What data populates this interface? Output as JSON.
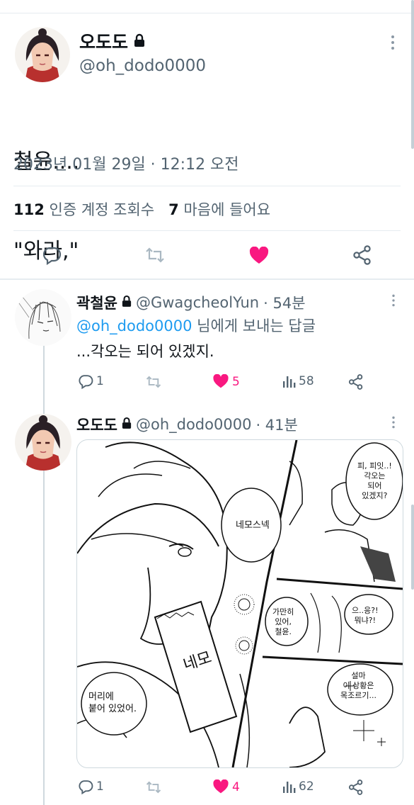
{
  "main_tweet": {
    "name": "오도도",
    "handle": "@oh_dodo0000",
    "text_line1": "철윤....",
    "text_line2": "\"와라,\"",
    "timestamp": "2023년 01월 29일 · 12:12 오전",
    "views_count": "112",
    "views_label": "인증 계정 조회수",
    "likes_count": "7",
    "likes_label": "마음에 들어요"
  },
  "reply1": {
    "name": "곽철윤",
    "handle": "@GwagcheolYun",
    "time": "· 54분",
    "reply_to_handle": "@oh_dodo0000",
    "reply_to_suffix": "님에게 보내는 답글",
    "text": "...각오는 되어 있겠지.",
    "replies": "1",
    "likes": "5",
    "views": "58"
  },
  "reply2": {
    "name": "오도도",
    "handle": "@oh_dodo0000",
    "time": "· 41분",
    "replies": "1",
    "likes": "4",
    "views": "62",
    "comic": {
      "bubble_nemo": "네모스넥",
      "bubble_hair": "머리에\n붙어 있었어.",
      "bubble_top_right": "피, 피잇..!\n각오는\n되어\n있겠지?",
      "bubble_mid_left": "가만히\n있어,\n철윤.",
      "bubble_mid_right": "으..응?!\n뭐냐?!",
      "bubble_bottom": "설마\n이 상황은\n목조르기...",
      "snack_label": "네모"
    }
  },
  "colors": {
    "like_pink": "#f91880",
    "link_blue": "#1d9bf0",
    "muted": "#536471"
  },
  "icons": [
    "lock-icon",
    "more-icon",
    "reply-icon",
    "retweet-icon",
    "heart-icon",
    "share-icon",
    "views-icon"
  ]
}
